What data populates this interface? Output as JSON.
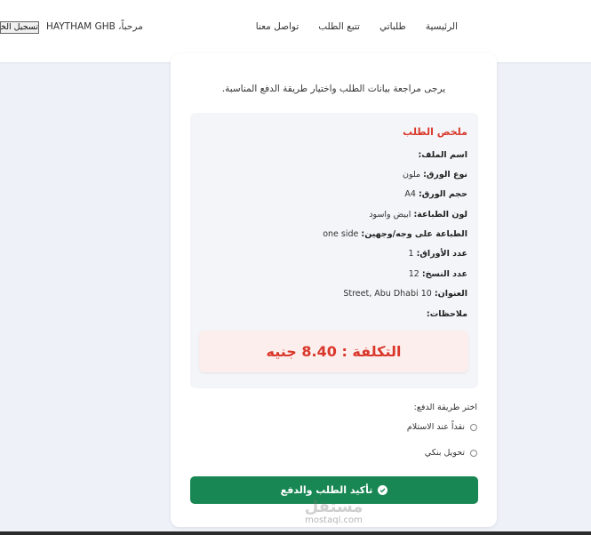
{
  "header": {
    "nav": [
      "الرئيسية",
      "طلباتي",
      "تتبع الطلب",
      "تواصل معنا"
    ],
    "greeting": "مرحباً، HAYTHAM GHB",
    "logout_label": "تسجيل الخروج"
  },
  "page": {
    "subtitle": "يرجى مراجعة بيانات الطلب واختيار طريقة الدفع المناسبة."
  },
  "summary": {
    "title": "ملخص الطلب",
    "rows": [
      {
        "label": "اسم الملف:",
        "value": ""
      },
      {
        "label": "نوع الورق:",
        "value": "ملون"
      },
      {
        "label": "حجم الورق:",
        "value": "A4"
      },
      {
        "label": "لون الطباعة:",
        "value": "ابيض واسود"
      },
      {
        "label": "الطباعة على وجه/وجهين:",
        "value": "one side"
      },
      {
        "label": "عدد الأوراق:",
        "value": "1"
      },
      {
        "label": "عدد النسخ:",
        "value": "12"
      },
      {
        "label": "العنوان:",
        "value": "10 Street, Abu Dhabi"
      },
      {
        "label": "ملاحظات:",
        "value": ""
      }
    ],
    "cost": "التكلفة : 8.40 جنيه"
  },
  "payment": {
    "label": "اختر طريقة الدفع:",
    "options": [
      "نقداً عند الاستلام",
      "تحويل بنكي"
    ]
  },
  "confirm_label": "تأكيد الطلب والدفع",
  "watermark": {
    "ar": "مستقل",
    "en": "mostaql.com"
  },
  "colors": {
    "accent": "#d9372a",
    "button": "#198754",
    "title": "#1f3a5f"
  }
}
